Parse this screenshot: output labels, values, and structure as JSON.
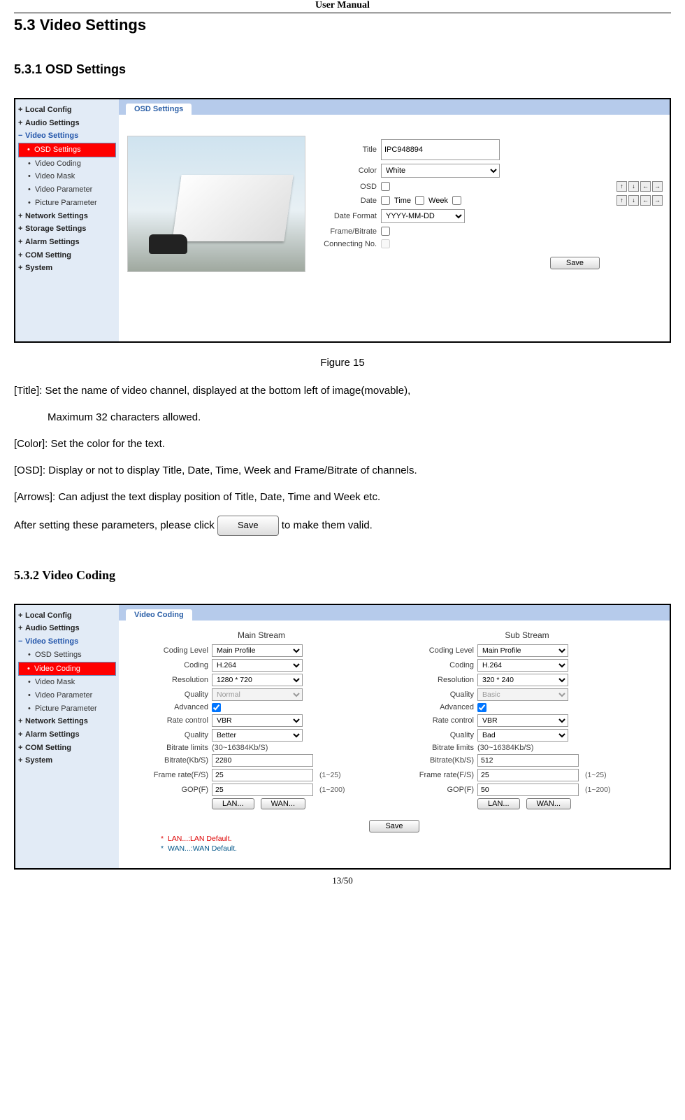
{
  "doc": {
    "header": "User Manual",
    "page_number": "13/50",
    "section_main": "5.3 Video Settings",
    "section_osd": "5.3.1 OSD Settings",
    "section_vc": "5.3.2 Video Coding",
    "figure15": "Figure 15"
  },
  "desc": {
    "title": "[Title]: Set the name of video channel, displayed at the bottom left of image(movable),",
    "title2": "Maximum 32 characters allowed.",
    "color": "[Color]: Set the color for the text.",
    "osd": "[OSD]: Display or not to display Title, Date, Time, Week and Frame/Bitrate of channels.",
    "arrows": "[Arrows]: Can adjust the text display position of Title, Date, Time and Week etc.",
    "pre_click": " After setting these parameters, please click ",
    "save_txt": "Save",
    "post_click": " to make them valid."
  },
  "nav": {
    "local": "Local Config",
    "audio": "Audio Settings",
    "video": "Video Settings",
    "osd": "OSD Settings",
    "coding": "Video Coding",
    "mask": "Video Mask",
    "param": "Video Parameter",
    "pic": "Picture Parameter",
    "net": "Network Settings",
    "storage": "Storage Settings",
    "alarm": "Alarm Settings",
    "com": "COM Setting",
    "system": "System",
    "plus": "+",
    "minus": "−",
    "dot": "•"
  },
  "osd_panel": {
    "tab": "OSD Settings",
    "title_lbl": "Title",
    "title_val": "IPC948894",
    "color_lbl": "Color",
    "color_val": "White",
    "osd_lbl": "OSD",
    "date_lbl": "Date",
    "time_lbl": "Time",
    "week_lbl": "Week",
    "datefmt_lbl": "Date Format",
    "datefmt_val": "YYYY-MM-DD",
    "fb_lbl": "Frame/Bitrate",
    "conn_lbl": "Connecting No.",
    "save": "Save",
    "arrows": {
      "up": "↑",
      "down": "↓",
      "left": "←",
      "right": "→"
    }
  },
  "vc_panel": {
    "tab": "Video Coding",
    "main_hdr": "Main Stream",
    "sub_hdr": "Sub Stream",
    "labels": {
      "clevel": "Coding Level",
      "coding": "Coding",
      "res": "Resolution",
      "quality": "Quality",
      "adv": "Advanced",
      "rate": "Rate control",
      "quality2": "Quality",
      "blimits": "Bitrate limits",
      "bitrate": "Bitrate(Kb/S)",
      "frate": "Frame rate(F/S)",
      "gop": "GOP(F)"
    },
    "main": {
      "clevel": "Main Profile",
      "coding": "H.264",
      "res": "1280 * 720",
      "quality": "Normal",
      "rate": "VBR",
      "quality2": "Better",
      "blimits": "(30~16384Kb/S)",
      "bitrate": "2280",
      "frate": "25",
      "frate_hint": "(1~25)",
      "gop": "25",
      "gop_hint": "(1~200)"
    },
    "sub": {
      "clevel": "Main Profile",
      "coding": "H.264",
      "res": "320 * 240",
      "quality": "Basic",
      "rate": "VBR",
      "quality2": "Bad",
      "blimits": "(30~16384Kb/S)",
      "bitrate": "512",
      "frate": "25",
      "frate_hint": "(1~25)",
      "gop": "50",
      "gop_hint": "(1~200)"
    },
    "lan_btn": "LAN...",
    "wan_btn": "WAN...",
    "save": "Save",
    "note_lan": "LAN...:LAN Default.",
    "note_wan": "WAN...:WAN Default.",
    "star": "*"
  }
}
